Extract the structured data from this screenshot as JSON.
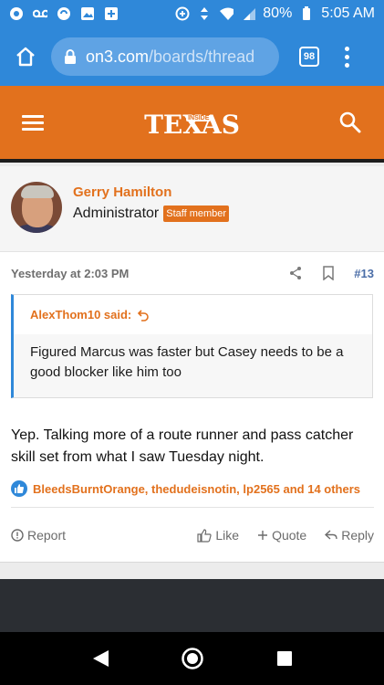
{
  "status_bar": {
    "battery_percent": "80%",
    "time": "5:05 AM"
  },
  "browser": {
    "url_domain": "on3.com",
    "url_path": "/boards/thread",
    "tab_count": "98"
  },
  "site": {
    "logo_text": "TEXAS",
    "logo_badge": "INSIDE",
    "accent_color": "#e2711d",
    "link_color": "#2f88d9"
  },
  "post": {
    "author": "Gerry Hamilton",
    "role": "Administrator",
    "badge": "Staff member",
    "timestamp": "Yesterday at 2:03 PM",
    "post_number": "#13",
    "quote": {
      "author_line": "AlexThom10 said:",
      "text": "Figured Marcus was faster but Casey needs to be a good blocker like him too"
    },
    "body": "Yep. Talking more of a route runner and pass catcher skill set from what I saw Tuesday night.",
    "reactions": "BleedsBurntOrange, thedudeisnotin, lp2565 and 14 others",
    "actions": {
      "report": "Report",
      "like": "Like",
      "quote": "Quote",
      "reply": "Reply"
    }
  }
}
